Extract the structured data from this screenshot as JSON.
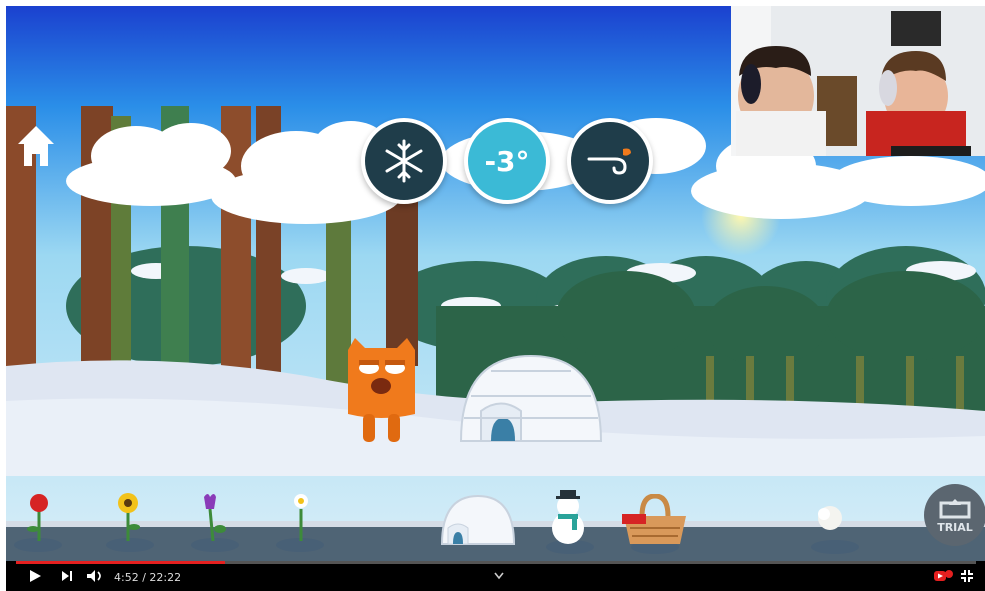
{
  "hud": {
    "weather_icon": "snowflake-icon",
    "temperature": "-3°",
    "wind_icon": "wind-icon"
  },
  "tray": {
    "items": [
      {
        "name": "red-flower"
      },
      {
        "name": "sunflower"
      },
      {
        "name": "purple-tulip"
      },
      {
        "name": "white-daisy"
      },
      {
        "name": "igloo"
      },
      {
        "name": "snowman"
      },
      {
        "name": "picnic-basket"
      },
      {
        "name": "snowball"
      }
    ],
    "trial_label": "TRIAL"
  },
  "player": {
    "time": "4:52 / 22:22",
    "progress": 0.218,
    "accent_color": "#e52020"
  },
  "colors": {
    "sky_top": "#1f4ed6",
    "sky_light": "#7fd0f2",
    "snow": "#e8eef7",
    "character": "#f07a1c"
  }
}
